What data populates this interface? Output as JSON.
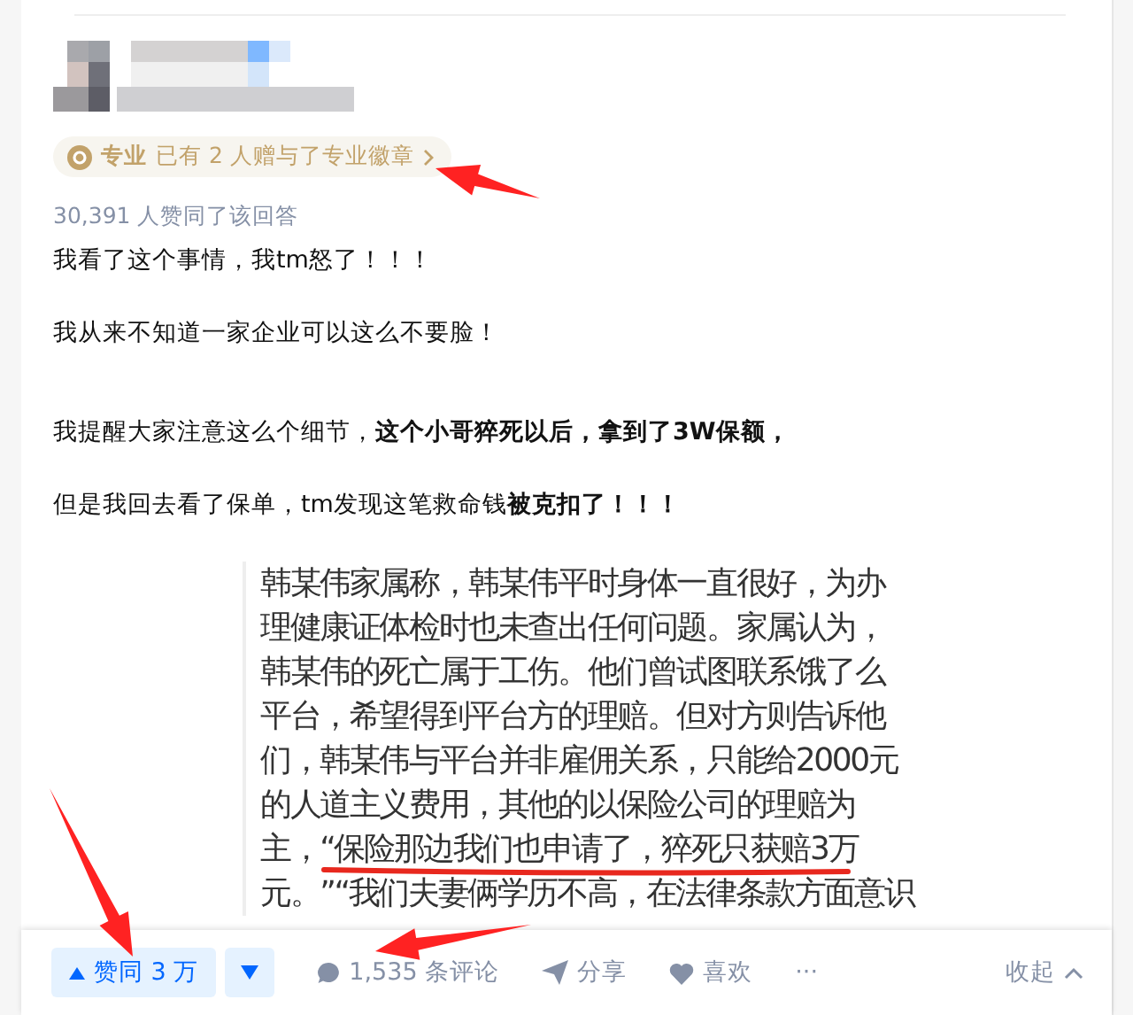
{
  "badge": {
    "label": "专业",
    "text": "已有 2 人赠与了专业徽章"
  },
  "vote_summary": "30,391 人赞同了该回答",
  "paragraphs": [
    "我看了这个事情，我tm怒了！！！",
    "我从来不知道一家企业可以这么不要脸！",
    "我提醒大家注意这么个细节，**这个小哥猝死以后，拿到了3W保额，**",
    "但是我回去看了保单，tm发现这笔救命钱**被克扣了！！！**"
  ],
  "quote_image": {
    "lines": [
      "韩某伟家属称，韩某伟平时身体一直很好，为办",
      "理健康证体检时也未查出任何问题。家属认为，",
      "韩某伟的死亡属于工伤。他们曾试图联系饿了么",
      "平台，希望得到平台方的理赔。但对方则告诉他",
      "们，韩某伟与平台并非雇佣关系，只能给2000元",
      "的人道主义费用，其他的以保险公司的理赔为",
      "主，“保险那边我们也申请了，猝死只获赔3万",
      "元。”“我们夫妻俩学历不高，在法律条款方面意识"
    ]
  },
  "actions": {
    "vote_up": "赞同 3 万",
    "comments": "1,535 条评论",
    "share": "分享",
    "like": "喜欢",
    "more": "···",
    "collapse": "收起"
  }
}
